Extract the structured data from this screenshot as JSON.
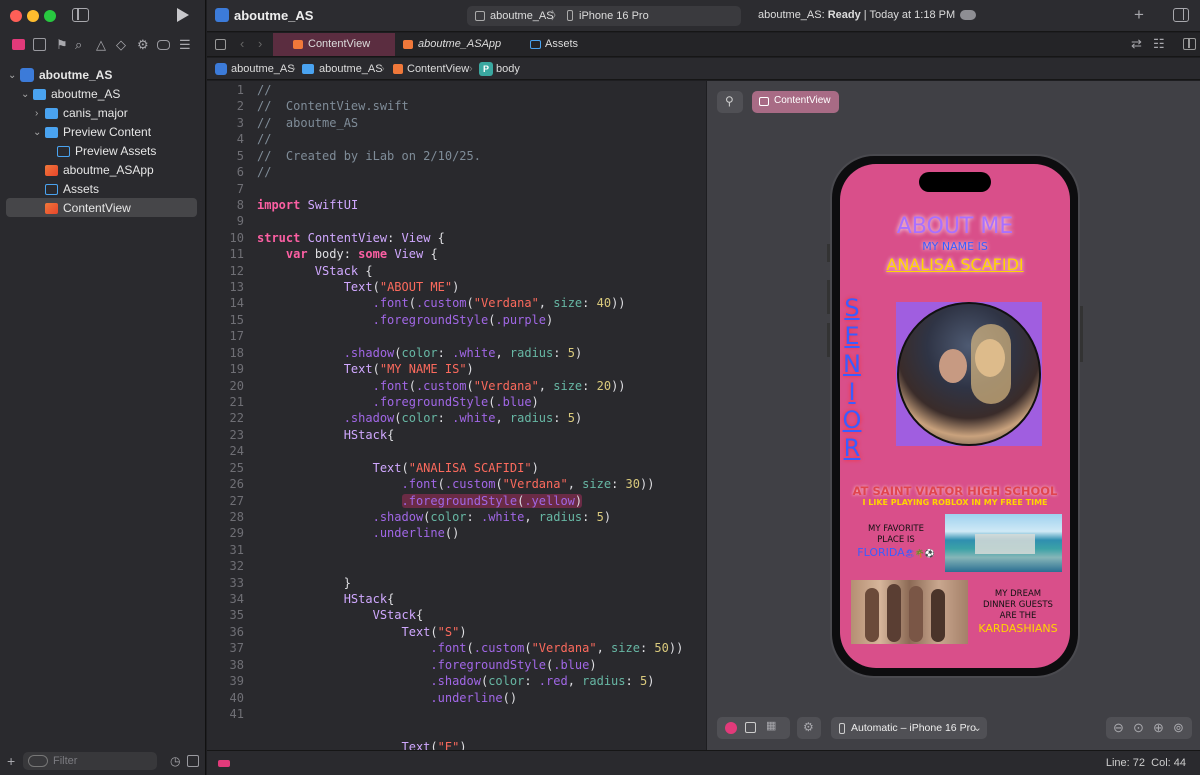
{
  "window": {
    "project_title": "aboutme_AS",
    "scheme": "aboutme_AS",
    "destination": "iPhone 16 Pro",
    "status_prefix": "aboutme_AS: ",
    "status_bold": "Ready",
    "status_suffix": " | Today at 1:18 PM"
  },
  "navigator": {
    "items": [
      {
        "label": "aboutme_AS",
        "kind": "project",
        "indent": 0,
        "expanded": true
      },
      {
        "label": "aboutme_AS",
        "kind": "folder",
        "indent": 1,
        "expanded": true
      },
      {
        "label": "canis_major",
        "kind": "folder",
        "indent": 2,
        "expanded": false
      },
      {
        "label": "Preview Content",
        "kind": "folder",
        "indent": 2,
        "expanded": true
      },
      {
        "label": "Preview Assets",
        "kind": "assets",
        "indent": 3
      },
      {
        "label": "aboutme_ASApp",
        "kind": "swift",
        "indent": 2
      },
      {
        "label": "Assets",
        "kind": "assets",
        "indent": 2
      },
      {
        "label": "ContentView",
        "kind": "swift",
        "indent": 2,
        "selected": true
      }
    ],
    "filter_placeholder": "Filter"
  },
  "tabs": [
    {
      "label": "ContentView",
      "active": true
    },
    {
      "label": "aboutme_ASApp",
      "italic": true
    },
    {
      "label": "Assets"
    }
  ],
  "breadcrumb": [
    "aboutme_AS",
    "aboutme_AS",
    "ContentView",
    "body"
  ],
  "editor": {
    "start_line": 1,
    "lines": [
      "//",
      "//  ContentView.swift",
      "//  aboutme_AS",
      "//",
      "//  Created by iLab on 2/10/25.",
      "//",
      "",
      "import SwiftUI",
      "",
      "struct ContentView: View {",
      "    var body: some View {",
      "        VStack {",
      "            Text(\"ABOUT ME\")",
      "                .font(.custom(\"Verdana\", size: 40))",
      "                .foregroundStyle(.purple)",
      "",
      "            .shadow(color: .white, radius: 5)",
      "            Text(\"MY NAME IS\")",
      "                .font(.custom(\"Verdana\", size: 20))",
      "                .foregroundStyle(.blue)",
      "            .shadow(color: .white, radius: 5)",
      "            HStack{",
      "",
      "                Text(\"ANALISA SCAFIDI\")",
      "                    .font(.custom(\"Verdana\", size: 30))",
      "                    .foregroundStyle(.yellow)",
      "                .shadow(color: .white, radius: 5)",
      "                .underline()",
      "",
      "",
      "            }",
      "            HStack{",
      "                VStack{",
      "                    Text(\"S\")",
      "                        .font(.custom(\"Verdana\", size: 50))",
      "                        .foregroundStyle(.blue)",
      "                        .shadow(color: .red, radius: 5)",
      "                        .underline()",
      "",
      "",
      "                    Text(\"E\")"
    ],
    "line_numbers": [
      1,
      2,
      3,
      4,
      5,
      6,
      7,
      8,
      9,
      10,
      11,
      12,
      13,
      14,
      15,
      17,
      18,
      19,
      20,
      21,
      22,
      23,
      24,
      25,
      26,
      27,
      28,
      29,
      31,
      32,
      33,
      34,
      35,
      36,
      37,
      38,
      39,
      40,
      41
    ]
  },
  "canvas": {
    "preview_label": "ContentView",
    "device_menu": "Automatic – iPhone 16 Pro",
    "phone": {
      "title": "ABOUT ME",
      "subtitle": "MY NAME IS",
      "name": "ANALISA SCAFIDI",
      "vertical": [
        "S",
        "E",
        "N",
        "I",
        "O",
        "R"
      ],
      "school": "AT SAINT VIATOR HIGH SCHOOL",
      "hobby": "I LIKE PLAYING ROBLOX IN MY FREE TIME",
      "fav_line1": "MY FAVORITE",
      "fav_line2": "PLACE IS",
      "fav_place": "FLORIDA",
      "fav_emoji": "🏖🌴⚽",
      "dream_line1": "MY DREAM",
      "dream_line2": "DINNER GUESTS",
      "dream_line3": "ARE THE",
      "dream_name": "KARDASHIANS"
    }
  },
  "statusbar": {
    "line_col": "Line: 72  Col: 44"
  },
  "colors": {
    "phone_bg": "#d94f8a",
    "purple_box": "#a05ee0",
    "accent_pink": "#e23a7a"
  }
}
